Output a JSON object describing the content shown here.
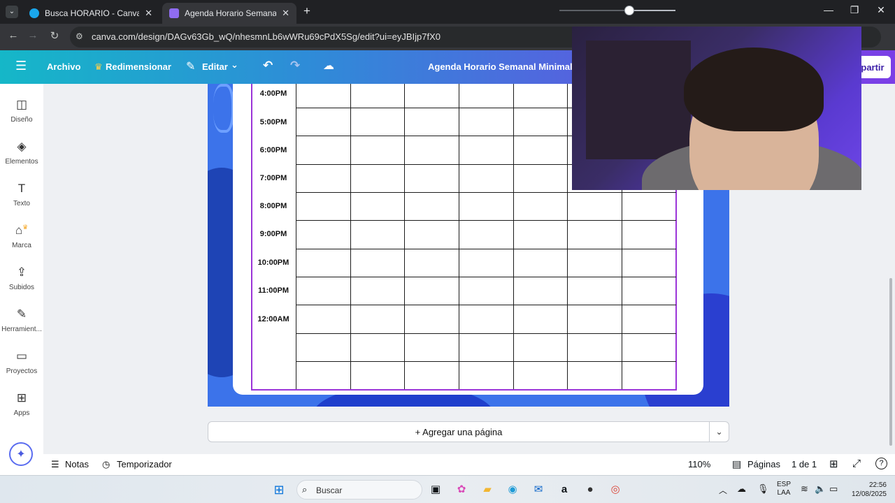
{
  "browser": {
    "tabs": [
      {
        "title": "Busca HORARIO - Canva",
        "active": false
      },
      {
        "title": "Agenda Horario Semanal Minimalista",
        "active": true
      }
    ],
    "url": "canva.com/design/DAGv63Gb_wQ/nhesmnLb6wWRu69cPdX5Sg/edit?ui=eyJBIjp7fX0"
  },
  "header": {
    "file_label": "Archivo",
    "resize_label": "Redimensionar",
    "edit_label": "Editar",
    "design_title": "Agenda Horario Semanal Minimalista",
    "share_label": "partir"
  },
  "sidebar": {
    "items": [
      {
        "label": "Diseño",
        "icon": "layout-icon"
      },
      {
        "label": "Elementos",
        "icon": "shapes-icon"
      },
      {
        "label": "Texto",
        "icon": "text-icon"
      },
      {
        "label": "Marca",
        "icon": "brand-icon"
      },
      {
        "label": "Subidos",
        "icon": "upload-icon"
      },
      {
        "label": "Herramient...",
        "icon": "pen-icon"
      },
      {
        "label": "Proyectos",
        "icon": "folder-icon"
      },
      {
        "label": "Apps",
        "icon": "apps-icon"
      }
    ]
  },
  "schedule": {
    "times": [
      "4:00PM",
      "5:00PM",
      "6:00PM",
      "7:00PM",
      "8:00PM",
      "9:00PM",
      "10:00PM",
      "11:00PM",
      "12:00AM"
    ]
  },
  "add_page_label": "+ Agregar una página",
  "footer": {
    "notes_label": "Notas",
    "timer_label": "Temporizador",
    "zoom_percent": 110,
    "zoom_label": "110%",
    "pages_label": "Páginas",
    "page_count": "1 de 1"
  },
  "taskbar": {
    "search_placeholder": "Buscar",
    "lang_top": "ESP",
    "lang_bottom": "LAA",
    "time": "22:56",
    "date": "12/08/2025"
  },
  "colors": {
    "header_start": "#15b7c8",
    "header_end": "#7b3ee6",
    "design_blue": "#3c73ea",
    "table_border": "#9b34d8"
  }
}
